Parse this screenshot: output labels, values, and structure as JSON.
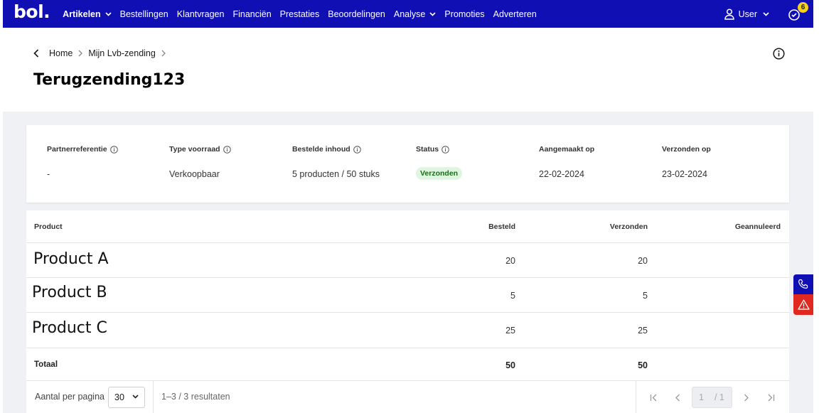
{
  "brand": {
    "logo_text": "bol."
  },
  "nav": {
    "items": [
      {
        "label": "Artikelen",
        "bold": true,
        "dropdown": true
      },
      {
        "label": "Bestellingen"
      },
      {
        "label": "Klantvragen"
      },
      {
        "label": "Financiën"
      },
      {
        "label": "Prestaties"
      },
      {
        "label": "Beoordelingen"
      },
      {
        "label": "Analyse",
        "dropdown": true
      },
      {
        "label": "Promoties"
      },
      {
        "label": "Adverteren"
      }
    ],
    "user_label": "User",
    "notification_count": "6"
  },
  "breadcrumb": {
    "home": "Home",
    "parent": "Mijn Lvb-zending"
  },
  "page_title": "Terugzending123",
  "summary": {
    "partnerreferentie": {
      "label": "Partnerreferentie",
      "value": "-"
    },
    "type_voorraad": {
      "label": "Type voorraad",
      "value": "Verkoopbaar"
    },
    "bestelde_inhoud": {
      "label": "Bestelde inhoud",
      "value": "5 producten / 50 stuks"
    },
    "status": {
      "label": "Status",
      "value": "Verzonden"
    },
    "aangemaakt_op": {
      "label": "Aangemaakt op",
      "value": "22-02-2024"
    },
    "verzonden_op": {
      "label": "Verzonden op",
      "value": "23-02-2024"
    }
  },
  "table": {
    "headers": {
      "product": "Product",
      "besteld": "Besteld",
      "verzonden": "Verzonden",
      "geannuleerd": "Geannuleerd"
    },
    "rows": [
      {
        "product": "Product A",
        "besteld": "20",
        "verzonden": "20",
        "geannuleerd": ""
      },
      {
        "product": "Product B",
        "besteld": "5",
        "verzonden": "5",
        "geannuleerd": ""
      },
      {
        "product": "Product C",
        "besteld": "25",
        "verzonden": "25",
        "geannuleerd": ""
      }
    ],
    "totals": {
      "label": "Totaal",
      "besteld": "50",
      "verzonden": "50"
    }
  },
  "pagination": {
    "per_page_label": "Aantal per pagina",
    "per_page_value": "30",
    "results_text": "1–3 / 3 resultaten",
    "current_page": "1",
    "total_pages": "/ 1"
  },
  "icons": {
    "back": "chevron-left-icon",
    "info": "info-icon",
    "user": "user-icon",
    "notifications": "bell-icon",
    "call": "phone-icon",
    "warning": "warning-icon"
  },
  "colors": {
    "brand_blue": "#0f0fb4",
    "status_green_bg": "#dff5df",
    "status_green_text": "#1a6b1a",
    "badge_yellow": "#f7d117",
    "warning_red": "#e0281e"
  }
}
